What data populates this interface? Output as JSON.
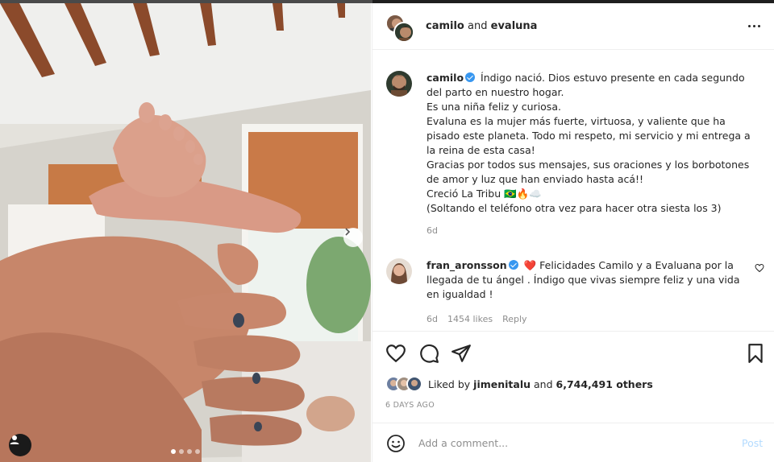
{
  "header": {
    "user1": "camilo",
    "connector": "and",
    "user2": "evaluna",
    "more_icon": "more-horizontal-icon"
  },
  "caption": {
    "username": "camilo",
    "lines": [
      "Índigo nació. Dios estuvo presente en cada segundo del parto en nuestro hogar.",
      "Es una niña feliz y curiosa.",
      "Evaluna es la mujer más fuerte, virtuosa, y valiente que ha pisado este planeta. Todo mi respeto, mi servicio y mi entrega a la reina de esta casa!",
      "Gracias por todos sus mensajes, sus oraciones y los borbotones de amor y luz que han enviado hasta acá!!",
      "Creció La Tribu 🇧🇷🔥☁️",
      "(Soltando el teléfono otra vez para hacer otra siesta los 3)"
    ],
    "time": "6d"
  },
  "comment": {
    "username": "fran_aronsson",
    "text": "❤️ Felicidades Camilo y a Evaluana por la llegada de tu ángel . Índigo que vivas siempre feliz y una vida en igualdad !",
    "time": "6d",
    "likes": "1454 likes",
    "reply": "Reply"
  },
  "likes": {
    "prefix": "Liked by",
    "user": "jimenitalu",
    "and": "and",
    "count": "6,744,491 others"
  },
  "time_ago": "6 DAYS AGO",
  "add_comment": {
    "placeholder": "Add a comment...",
    "post": "Post"
  },
  "carousel": {
    "total": 4,
    "current": 1
  },
  "colors": {
    "verified": "#3897f0",
    "post_disabled": "#b3dbff",
    "heart": "#ed4956"
  }
}
